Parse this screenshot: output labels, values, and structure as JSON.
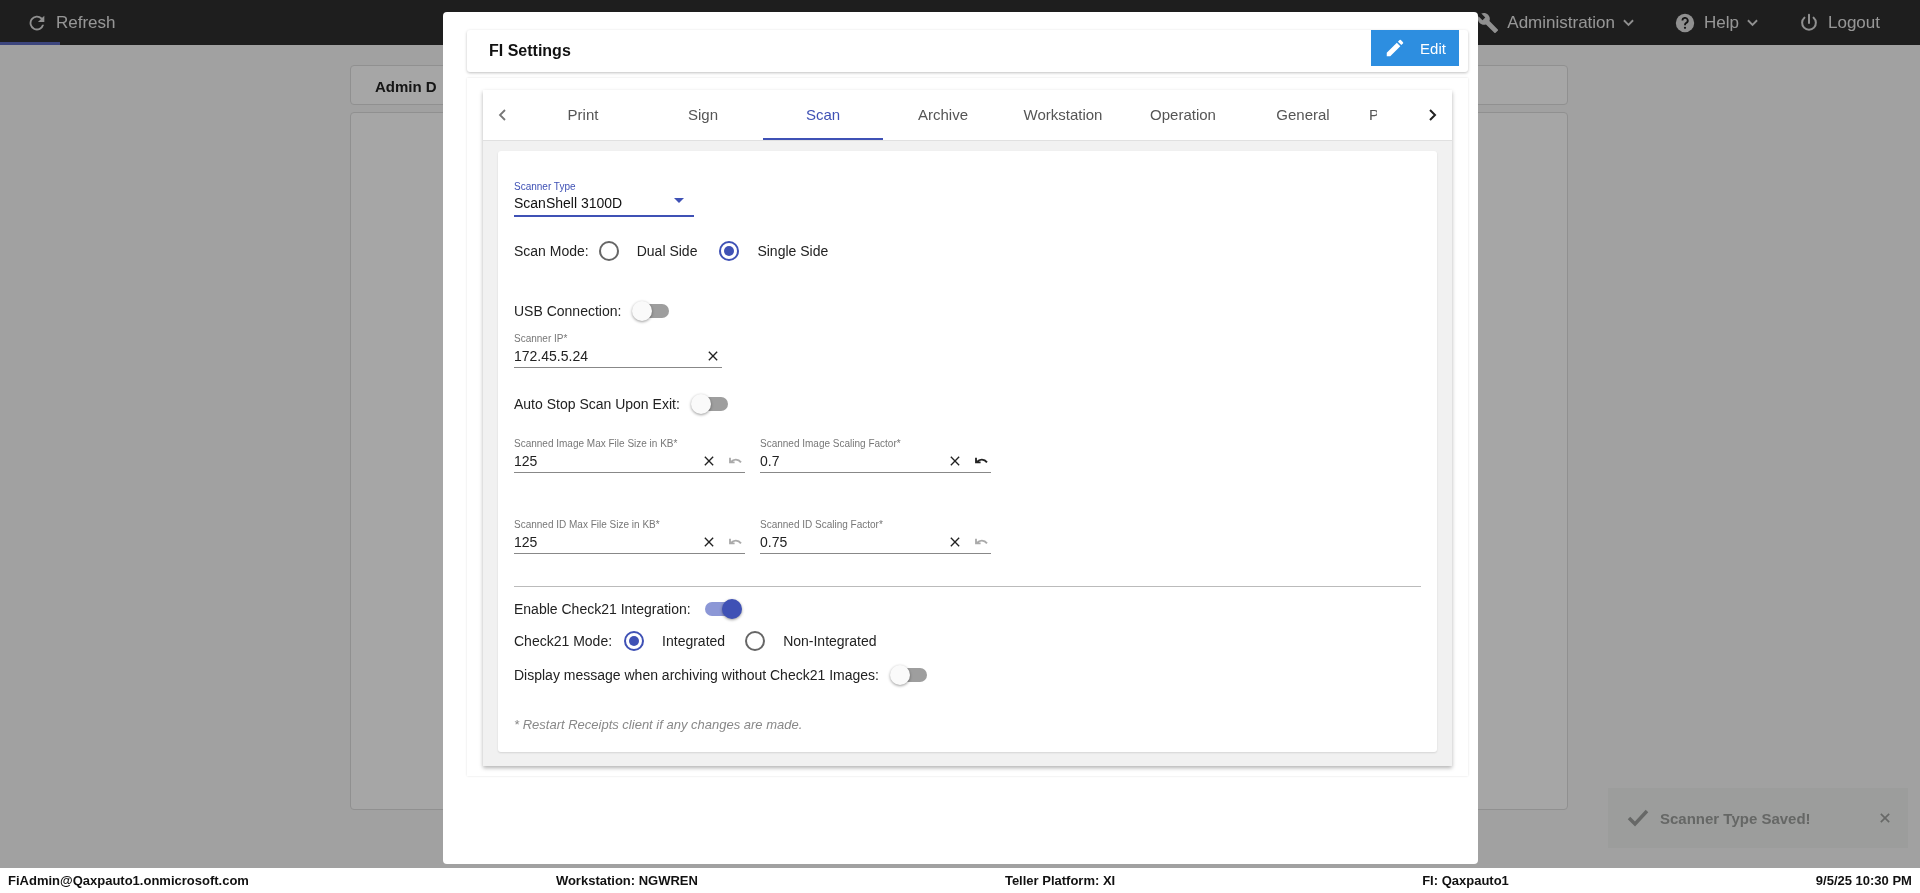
{
  "top_bar": {
    "refresh": "Refresh",
    "menus": [
      {
        "label": "Administration",
        "kind": "wrench"
      },
      {
        "label": "Help",
        "kind": "help"
      },
      {
        "label": "Logout",
        "kind": "power"
      }
    ]
  },
  "background": {
    "admin_tab": "Admin D",
    "toast": "Scanner Type Saved!"
  },
  "modal": {
    "title": "FI Settings",
    "edit_button": "Edit",
    "tabs": [
      {
        "label": "Print",
        "selected": false
      },
      {
        "label": "Sign",
        "selected": false
      },
      {
        "label": "Scan",
        "selected": true
      },
      {
        "label": "Archive",
        "selected": false
      },
      {
        "label": "Workstation",
        "selected": false
      },
      {
        "label": "Operation",
        "selected": false
      },
      {
        "label": "General",
        "selected": false
      },
      {
        "label": "P",
        "selected": false
      }
    ],
    "scanner_type": {
      "label": "Scanner Type",
      "value": "ScanShell 3100D"
    },
    "scan_mode": {
      "label": "Scan Mode:",
      "options": [
        {
          "label": "Dual Side",
          "selected": false
        },
        {
          "label": "Single Side",
          "selected": true
        }
      ]
    },
    "usb_connection": {
      "label": "USB Connection:",
      "on": false
    },
    "scanner_ip": {
      "label": "Scanner IP*",
      "value": "172.45.5.24"
    },
    "auto_stop": {
      "label": "Auto Stop Scan Upon Exit:",
      "on": false
    },
    "field_rows": [
      [
        {
          "label": "Scanned Image Max File Size in KB*",
          "value": "125",
          "undo_enabled": false
        },
        {
          "label": "Scanned Image Scaling Factor*",
          "value": "0.7",
          "undo_enabled": true
        }
      ],
      [
        {
          "label": "Scanned ID Max File Size in KB*",
          "value": "125",
          "undo_enabled": false
        },
        {
          "label": "Scanned ID Scaling Factor*",
          "value": "0.75",
          "undo_enabled": false
        }
      ]
    ],
    "check21": {
      "label": "Enable Check21 Integration:",
      "on": true
    },
    "check21_mode": {
      "label": "Check21 Mode:",
      "options": [
        {
          "label": "Integrated",
          "selected": true
        },
        {
          "label": "Non-Integrated",
          "selected": false
        }
      ]
    },
    "archive_message": {
      "label": "Display message when archiving without Check21 Images:",
      "on": false
    },
    "footnote": "* Restart Receipts client if any changes are made."
  },
  "status_bar": {
    "user": "FiAdmin@Qaxpauto1.onmicrosoft.com",
    "workstation": "Workstation: NGWREN",
    "platform": "Teller Platform: XI",
    "fi": "FI: Qaxpauto1",
    "datetime": "9/5/25 10:30 PM"
  }
}
